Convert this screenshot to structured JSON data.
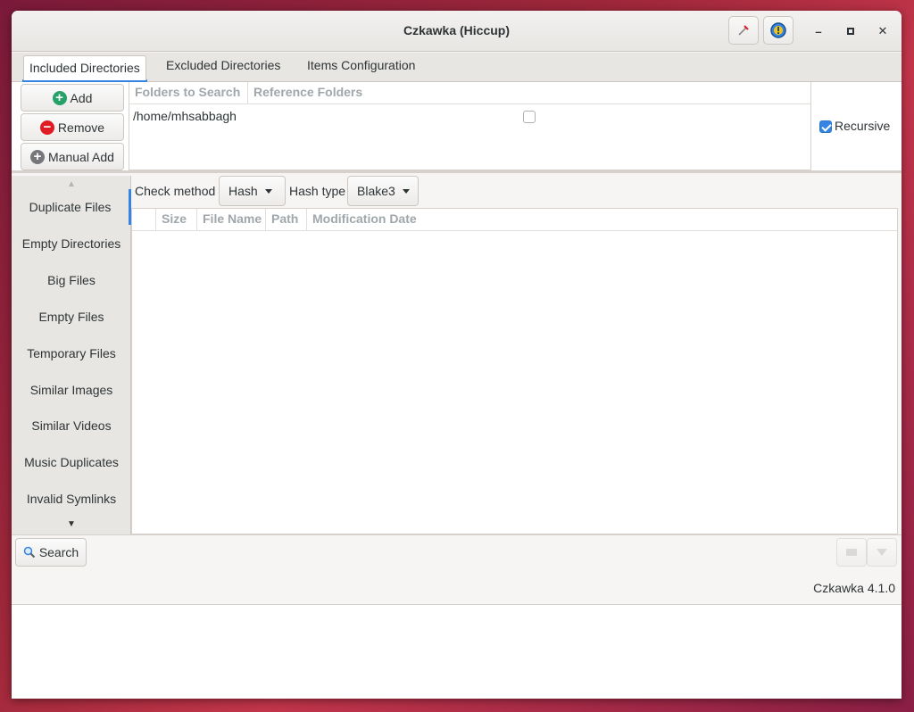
{
  "window": {
    "title": "Czkawka (Hiccup)"
  },
  "tabs": [
    {
      "label": "Included Directories",
      "active": true
    },
    {
      "label": "Excluded Directories"
    },
    {
      "label": "Items Configuration"
    }
  ],
  "dir_buttons": {
    "add": "Add",
    "remove": "Remove",
    "manual_add": "Manual Add"
  },
  "folders_table": {
    "headers": [
      "Folders to Search",
      "Reference Folders"
    ],
    "rows": [
      {
        "path": "/home/mhsabbagh",
        "reference": false
      }
    ]
  },
  "recursive": {
    "label": "Recursive",
    "checked": true
  },
  "sidebar": {
    "items": [
      {
        "label": "Duplicate Files",
        "active": true
      },
      {
        "label": "Empty Directories"
      },
      {
        "label": "Big Files"
      },
      {
        "label": "Empty Files"
      },
      {
        "label": "Temporary Files"
      },
      {
        "label": "Similar Images"
      },
      {
        "label": "Similar Videos"
      },
      {
        "label": "Music Duplicates"
      },
      {
        "label": "Invalid Symlinks"
      }
    ]
  },
  "options": {
    "check_method_label": "Check method",
    "check_method_value": "Hash",
    "hash_type_label": "Hash type",
    "hash_type_value": "Blake3"
  },
  "results_table": {
    "headers": [
      "Size",
      "File Name",
      "Path",
      "Modification Date"
    ]
  },
  "bottom": {
    "search_label": "Search",
    "version": "Czkawka 4.1.0"
  },
  "colors": {
    "accent": "#3584e4",
    "add_green": "#26a269",
    "remove_red": "#e01b24"
  }
}
